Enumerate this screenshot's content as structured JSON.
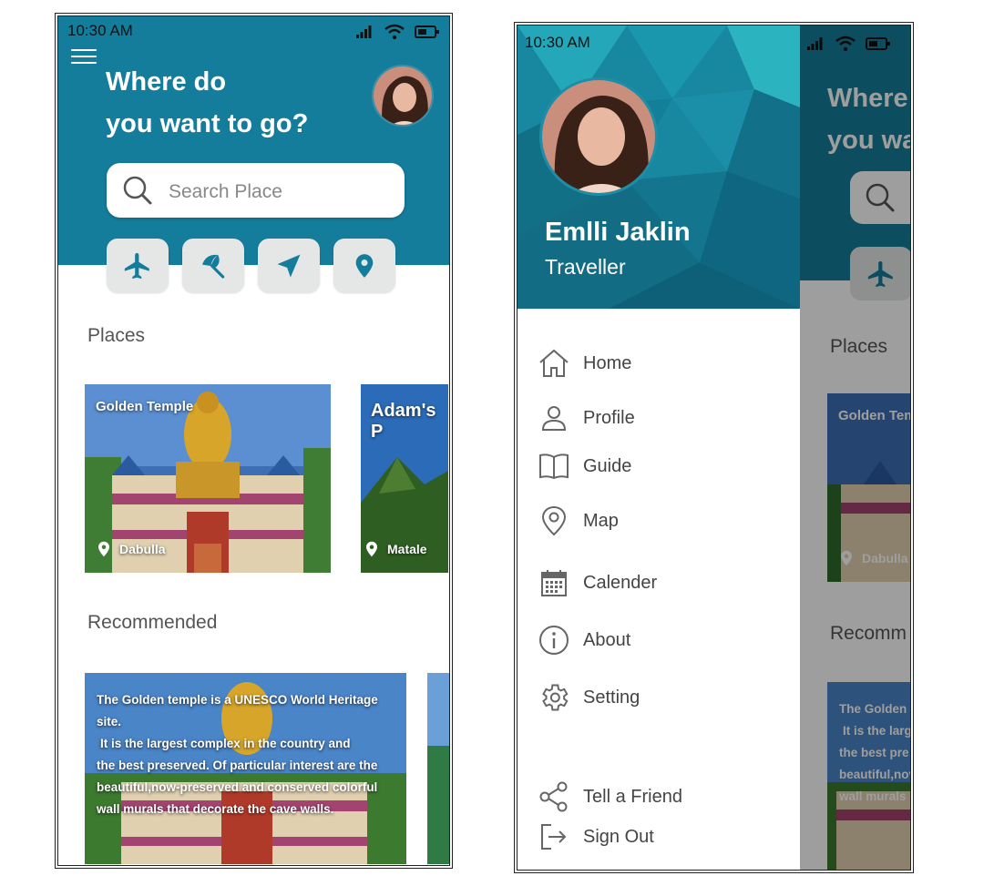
{
  "status": {
    "time": "10:30 AM"
  },
  "home": {
    "title_line1": "Where do",
    "title_line2": "you want to go?",
    "search_placeholder": "Search Place",
    "categories": [
      "plane-icon",
      "beach-umbrella-icon",
      "navigation-arrow-icon",
      "map-pin-icon"
    ],
    "places_heading": "Places",
    "places": [
      {
        "name": "Golden Temple",
        "location": "Dabulla"
      },
      {
        "name": "Adam's P",
        "location": "Matale"
      }
    ],
    "recommended_heading": "Recommended",
    "recommended_text": [
      "The Golden temple is a UNESCO World Heritage site.",
      "It is the largest complex in the country and",
      "the best preserved. Of particular interest are the",
      "beautiful,now-preserved and conserved colorful",
      "wall murals that decorate the cave walls."
    ]
  },
  "drawer": {
    "user_name": "Emlli Jaklin",
    "user_role": "Traveller",
    "menu": [
      "Home",
      "Profile",
      "Guide",
      "Map",
      "Calender",
      "About",
      "Setting"
    ],
    "footer": [
      "Tell a Friend",
      "Sign Out"
    ]
  },
  "background_partial": {
    "title_line1": "Where",
    "title_line2": "you wa",
    "places_heading": "Places",
    "place_name": "Golden Tem",
    "place_location": "Dabulla",
    "recommended_heading": "Recomm",
    "recommended_text": [
      "The Golden",
      "It is the larg",
      "the best pre",
      "beautiful,nov",
      "wall murals"
    ]
  },
  "colors": {
    "primary": "#147d9c",
    "card_bg": "#e5e7e7",
    "text_gray": "#555555"
  }
}
